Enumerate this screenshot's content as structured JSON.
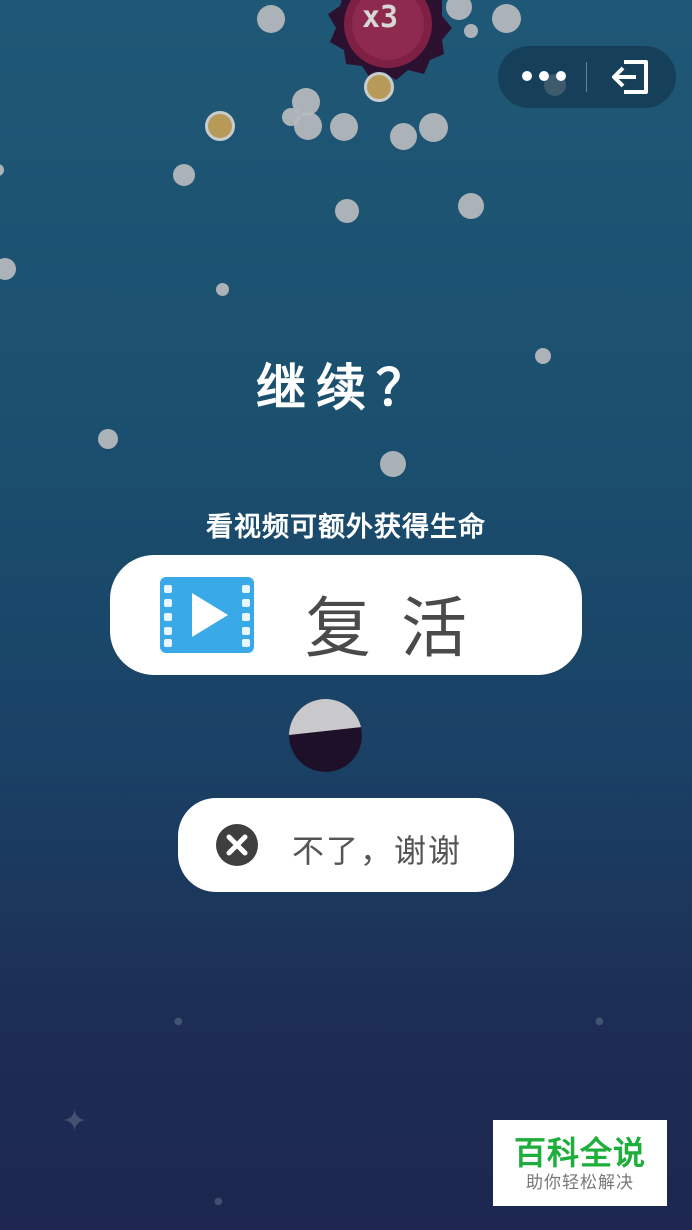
{
  "boss": {
    "multiplier": "x3"
  },
  "capsule": {
    "more_icon": "more-dots-icon",
    "exit_icon": "exit-icon"
  },
  "dialog": {
    "title": "继续？",
    "subtitle": "看视频可额外获得生命",
    "revive_label": "复活",
    "revive_icon": "video-play-icon",
    "decline_label": "不了，谢谢",
    "decline_icon": "close-circle-icon"
  },
  "watermark": {
    "brand": "百科全说",
    "tagline": "助你轻松解决"
  },
  "colors": {
    "background_top": "#1f5876",
    "background_bottom": "#1d2750",
    "accent_video": "#39a9e8",
    "watermark_green": "#1eae3c"
  }
}
